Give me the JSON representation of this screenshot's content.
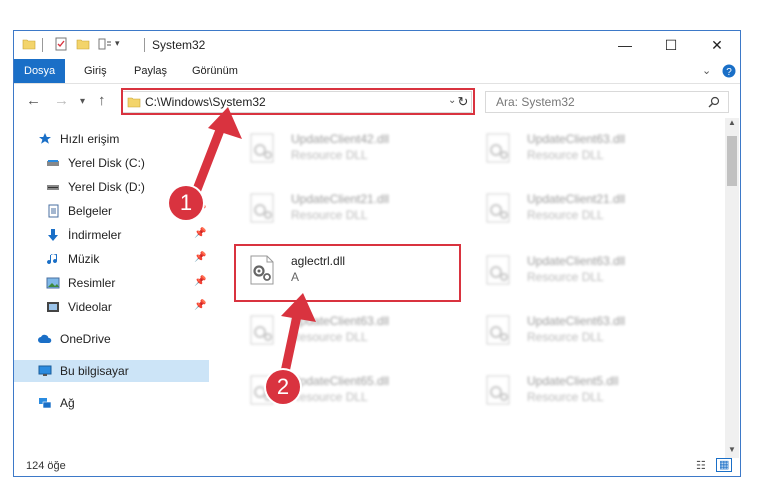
{
  "window": {
    "title": "System32"
  },
  "ribbon": {
    "tabs": [
      "Dosya",
      "Giriş",
      "Paylaş",
      "Görünüm"
    ]
  },
  "address": {
    "path": "C:\\Windows\\System32"
  },
  "search": {
    "placeholder": "Ara: System32"
  },
  "sidebar": {
    "items": [
      {
        "label": "Hızlı erişim",
        "icon": "star-icon"
      },
      {
        "label": "Yerel Disk (C:)",
        "icon": "drive-icon"
      },
      {
        "label": "Yerel Disk (D:)",
        "icon": "drive-icon"
      },
      {
        "label": "Belgeler",
        "icon": "documents-icon"
      },
      {
        "label": "İndirmeler",
        "icon": "download-icon"
      },
      {
        "label": "Müzik",
        "icon": "music-icon"
      },
      {
        "label": "Resimler",
        "icon": "pictures-icon"
      },
      {
        "label": "Videolar",
        "icon": "video-icon"
      },
      {
        "label": "OneDrive",
        "icon": "cloud-icon"
      },
      {
        "label": "Bu bilgisayar",
        "icon": "computer-icon"
      },
      {
        "label": "Ağ",
        "icon": "network-icon"
      }
    ]
  },
  "files": [
    {
      "name": "UpdateClient42.dll",
      "desc": "Resource DLL"
    },
    {
      "name": "UpdateClient63.dll",
      "desc": "Resource DLL"
    },
    {
      "name": "UpdateClient21.dll",
      "desc": "Resource DLL"
    },
    {
      "name": "UpdateClient21.dll",
      "desc": "Resource DLL"
    },
    {
      "name": "aglectrl.dll",
      "desc": "A"
    },
    {
      "name": "UpdateClient63.dll",
      "desc": "Resource DLL"
    },
    {
      "name": "UpdateClient63.dll",
      "desc": "Resource DLL"
    },
    {
      "name": "UpdateClient63.dll",
      "desc": "Resource DLL"
    },
    {
      "name": "UpdateClient65.dll",
      "desc": "Resource DLL"
    },
    {
      "name": "UpdateClient5.dll",
      "desc": "Resource DLL"
    }
  ],
  "status": {
    "count": "124 öğe"
  },
  "annotations": {
    "step1": "1",
    "step2": "2"
  },
  "colors": {
    "accent": "#1a6fc7",
    "highlight": "#d9333f"
  }
}
